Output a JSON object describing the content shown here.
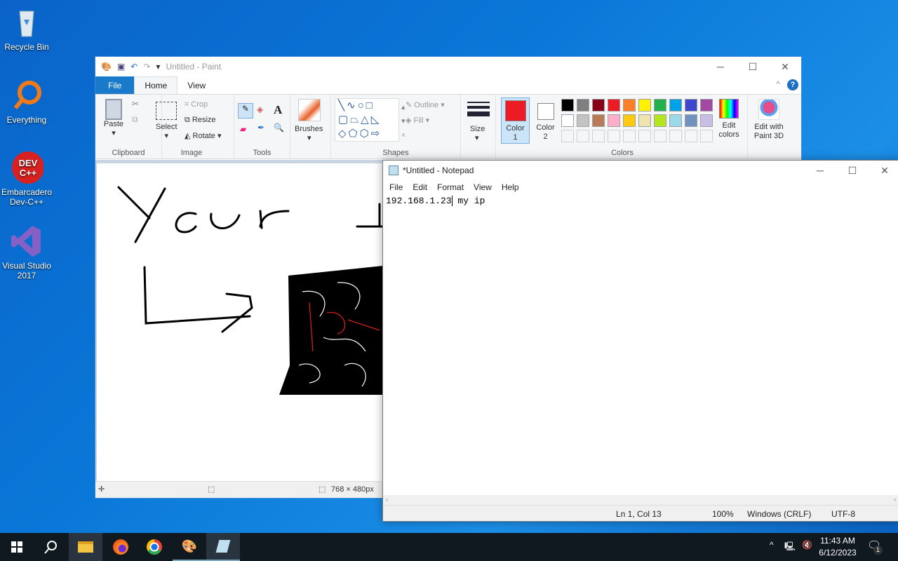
{
  "desktop": {
    "icons": [
      {
        "label": "Recycle Bin",
        "icon": "recycle-bin-icon"
      },
      {
        "label": "Everything",
        "icon": "everything-search-icon"
      },
      {
        "label": "Embarcadero Dev-C++",
        "icon": "devcpp-icon",
        "logo_text": "DEV C++"
      },
      {
        "label": "Visual Studio 2017",
        "icon": "visual-studio-icon"
      }
    ]
  },
  "paint": {
    "title": "Untitled - Paint",
    "tabs": {
      "file": "File",
      "home": "Home",
      "view": "View"
    },
    "clipboard": {
      "paste": "Paste",
      "label": "Clipboard"
    },
    "image": {
      "select": "Select",
      "crop": "Crop",
      "resize": "Resize",
      "rotate": "Rotate",
      "label": "Image"
    },
    "tools": {
      "label": "Tools",
      "text_glyph": "A"
    },
    "brushes": "Brushes",
    "shapes": {
      "label": "Shapes",
      "outline": "Outline",
      "fill": "Fill"
    },
    "size": "Size",
    "color1": "Color 1",
    "color1_value": "#ed1c24",
    "color2": "Color 2",
    "color2_value": "#ffffff",
    "palette_row1": [
      "#000000",
      "#7f7f7f",
      "#880015",
      "#ed1c24",
      "#ff7f27",
      "#fff200",
      "#22b14c",
      "#00a2e8",
      "#3f48cc",
      "#a349a4"
    ],
    "palette_row2": [
      "#ffffff",
      "#c3c3c3",
      "#b97a57",
      "#ffaec9",
      "#ffc90e",
      "#efe4b0",
      "#b5e61d",
      "#99d9ea",
      "#7092be",
      "#c8bfe7"
    ],
    "edit_colors": "Edit colors",
    "colors_label": "Colors",
    "edit_paint3d": "Edit with Paint 3D",
    "canvas_size": "768 × 480px"
  },
  "notepad": {
    "title": "*Untitled - Notepad",
    "menu": [
      "File",
      "Edit",
      "Format",
      "View",
      "Help"
    ],
    "content_before_cursor": "192.168.1.23",
    "content_after_cursor": " my ip",
    "status": {
      "position": "Ln 1, Col 13",
      "zoom": "100%",
      "line_ending": "Windows (CRLF)",
      "encoding": "UTF-8"
    }
  },
  "taskbar": {
    "time": "11:43 AM",
    "date": "6/12/2023",
    "notifications": "1",
    "apps": [
      "start-icon",
      "search-icon",
      "file-explorer-icon",
      "firefox-icon",
      "chrome-icon",
      "paint-icon",
      "notepad-icon"
    ]
  }
}
